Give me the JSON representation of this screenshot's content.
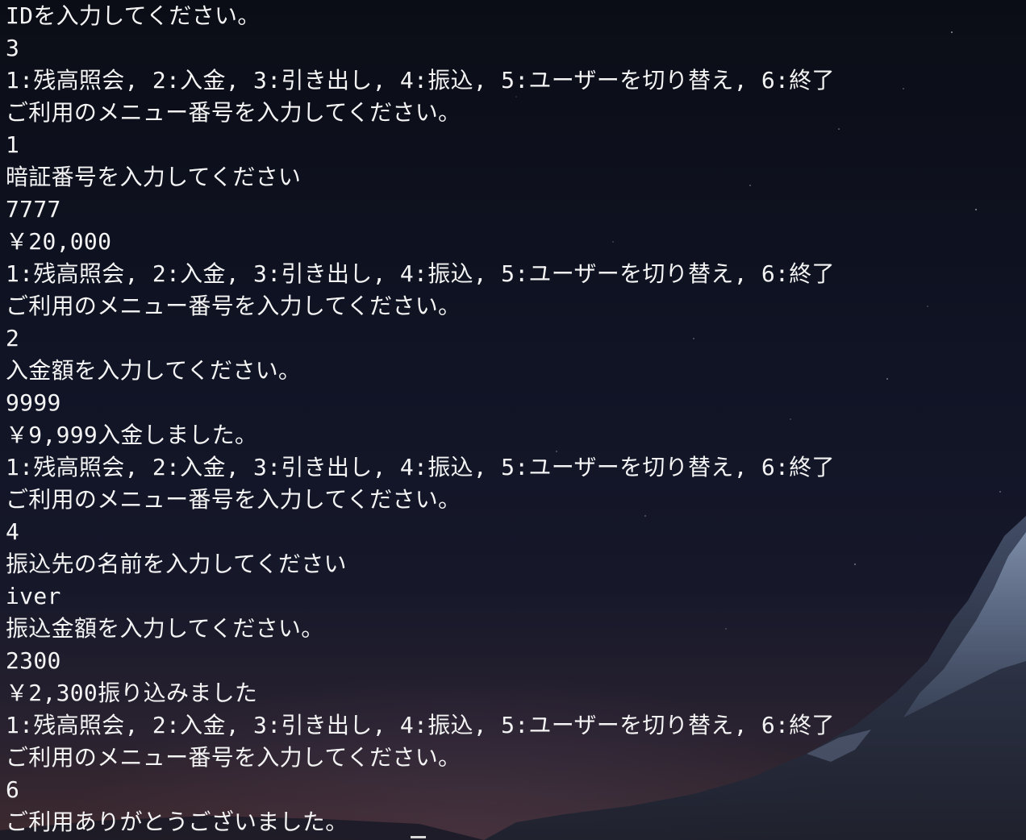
{
  "terminal": {
    "lines": [
      "IDを入力してください。",
      "3",
      "1:残高照会, 2:入金, 3:引き出し, 4:振込, 5:ユーザーを切り替え, 6:終了",
      "ご利用のメニュー番号を入力してください。",
      "1",
      "暗証番号を入力してください",
      "7777",
      "￥20,000",
      "1:残高照会, 2:入金, 3:引き出し, 4:振込, 5:ユーザーを切り替え, 6:終了",
      "ご利用のメニュー番号を入力してください。",
      "2",
      "入金額を入力してください。",
      "9999",
      "￥9,999入金しました。",
      "1:残高照会, 2:入金, 3:引き出し, 4:振込, 5:ユーザーを切り替え, 6:終了",
      "ご利用のメニュー番号を入力してください。",
      "4",
      "振込先の名前を入力してください",
      "iver",
      "振込金額を入力してください。",
      "2300",
      "￥2,300振り込みました",
      "1:残高照会, 2:入金, 3:引き出し, 4:振込, 5:ユーザーを切り替え, 6:終了",
      "ご利用のメニュー番号を入力してください。",
      "6",
      "ご利用ありがとうございました。"
    ]
  },
  "colors": {
    "text": "#f4f4f4",
    "background": "#0c0f1a"
  }
}
